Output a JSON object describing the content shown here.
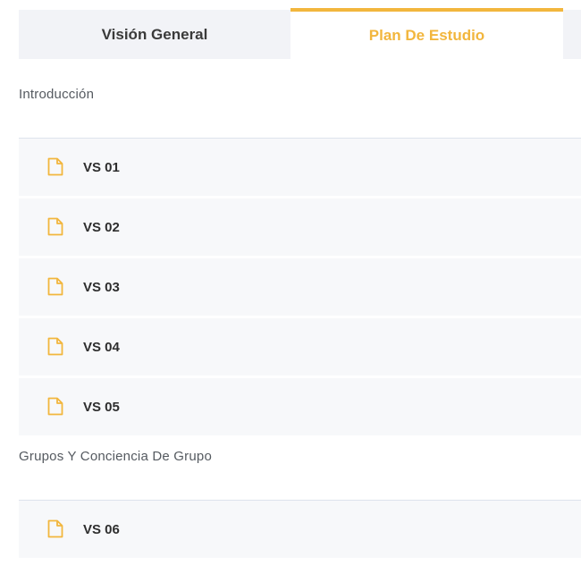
{
  "tabs": [
    {
      "label": "Visión General",
      "active": false
    },
    {
      "label": "Plan De Estudio",
      "active": true
    }
  ],
  "colors": {
    "accent": "#f2b63d",
    "tab_bg": "#f2f3f7",
    "row_bg": "#f7f8fa"
  },
  "sections": [
    {
      "title": "Introducción",
      "lessons": [
        {
          "label": "VS 01",
          "icon": "document-icon"
        },
        {
          "label": "VS 02",
          "icon": "document-icon"
        },
        {
          "label": "VS 03",
          "icon": "document-icon"
        },
        {
          "label": "VS 04",
          "icon": "document-icon"
        },
        {
          "label": "VS 05",
          "icon": "document-icon"
        }
      ]
    },
    {
      "title": "Grupos Y Conciencia De Grupo",
      "lessons": [
        {
          "label": "VS 06",
          "icon": "document-icon"
        }
      ]
    }
  ]
}
